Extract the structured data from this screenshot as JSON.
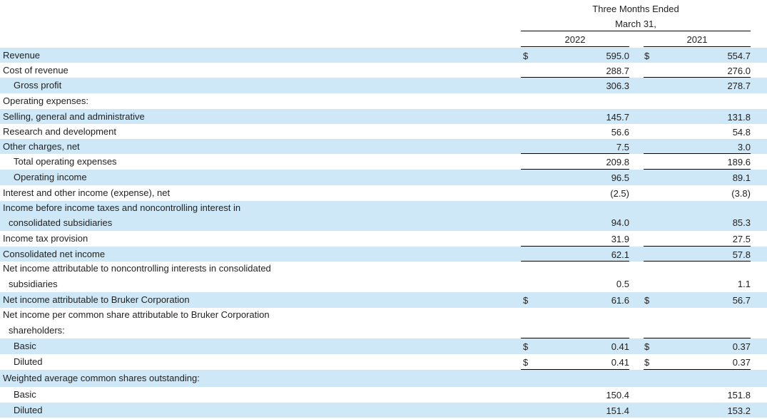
{
  "header": {
    "period_line1": "Three Months Ended",
    "period_line2": "March 31,",
    "year1": "2022",
    "year2": "2021"
  },
  "rows": [
    {
      "label": "Revenue",
      "c1": "$",
      "v1": "595.0",
      "c2": "$",
      "v2": "554.7"
    },
    {
      "label": "Cost of revenue",
      "c1": "",
      "v1": "288.7",
      "c2": "",
      "v2": "276.0"
    },
    {
      "label": "Gross profit",
      "c1": "",
      "v1": "306.3",
      "c2": "",
      "v2": "278.7"
    },
    {
      "label": "Operating expenses:",
      "c1": "",
      "v1": "",
      "c2": "",
      "v2": ""
    },
    {
      "label": "Selling, general and administrative",
      "c1": "",
      "v1": "145.7",
      "c2": "",
      "v2": "131.8"
    },
    {
      "label": "Research and development",
      "c1": "",
      "v1": "56.6",
      "c2": "",
      "v2": "54.8"
    },
    {
      "label": "Other charges, net",
      "c1": "",
      "v1": "7.5",
      "c2": "",
      "v2": "3.0"
    },
    {
      "label": "Total operating expenses",
      "c1": "",
      "v1": "209.8",
      "c2": "",
      "v2": "189.6"
    },
    {
      "label": "Operating income",
      "c1": "",
      "v1": "96.5",
      "c2": "",
      "v2": "89.1"
    },
    {
      "label": "Interest and other income (expense), net",
      "c1": "",
      "v1": "(2.5)",
      "c2": "",
      "v2": "(3.8)"
    },
    {
      "label": "Income before income taxes and noncontrolling interest in",
      "label2": "consolidated subsidiaries",
      "c1": "",
      "v1": "94.0",
      "c2": "",
      "v2": "85.3"
    },
    {
      "label": "Income tax provision",
      "c1": "",
      "v1": "31.9",
      "c2": "",
      "v2": "27.5"
    },
    {
      "label": "Consolidated net income",
      "c1": "",
      "v1": "62.1",
      "c2": "",
      "v2": "57.8"
    },
    {
      "label": "Net income attributable to noncontrolling interests in consolidated",
      "label2": "subsidiaries",
      "c1": "",
      "v1": "0.5",
      "c2": "",
      "v2": "1.1"
    },
    {
      "label": "Net income attributable to Bruker Corporation",
      "c1": "$",
      "v1": "61.6",
      "c2": "$",
      "v2": "56.7"
    },
    {
      "label": "Net income per common share attributable to Bruker Corporation",
      "label2": "shareholders:",
      "c1": "",
      "v1": "",
      "c2": "",
      "v2": ""
    },
    {
      "label": "Basic",
      "c1": "$",
      "v1": "0.41",
      "c2": "$",
      "v2": "0.37"
    },
    {
      "label": "Diluted",
      "c1": "$",
      "v1": "0.41",
      "c2": "$",
      "v2": "0.37"
    },
    {
      "label": "Weighted average common shares outstanding:",
      "c1": "",
      "v1": "",
      "c2": "",
      "v2": ""
    },
    {
      "label": "Basic",
      "c1": "",
      "v1": "150.4",
      "c2": "",
      "v2": "151.8"
    },
    {
      "label": "Diluted",
      "c1": "",
      "v1": "151.4",
      "c2": "",
      "v2": "153.2"
    }
  ]
}
